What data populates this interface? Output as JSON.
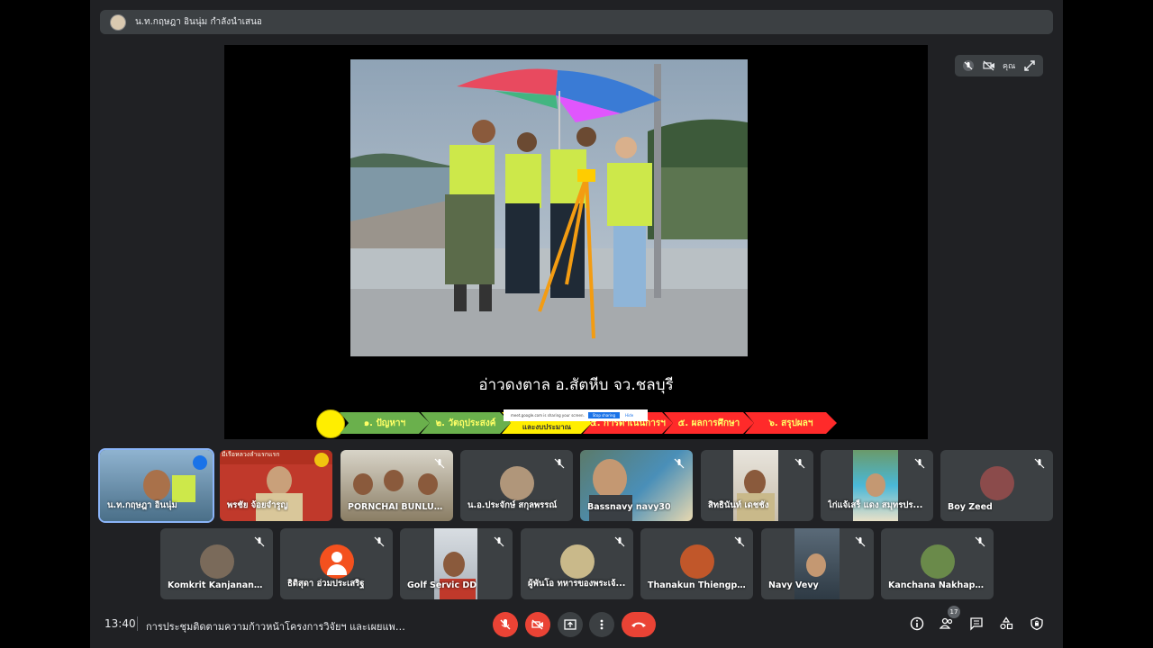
{
  "presenter": {
    "text": "น.ท.กฤษฎา อินนุ่ม กำลังนำเสนอ"
  },
  "slide": {
    "caption": "อ่าวดงตาล อ.สัตหีบ จว.ชลบุรี",
    "steps": [
      {
        "label": "๑. ปัญหาฯ",
        "color": "#6ab04c",
        "text_color": "#ffff66"
      },
      {
        "label": "๒. วัตถุประสงค์",
        "color": "#6ab04c",
        "text_color": "#ffff66"
      },
      {
        "label": "และงบประมาณ",
        "color": "#ffee00",
        "text_color": "#333333"
      },
      {
        "label": "๔. การดำเนินการฯ",
        "color": "#ff2a2a",
        "text_color": "#ffff66"
      },
      {
        "label": "๕. ผลการศึกษา",
        "color": "#ff2a2a",
        "text_color": "#ffff66"
      },
      {
        "label": "๖. สรุปผลฯ",
        "color": "#ff2a2a",
        "text_color": "#ffff66"
      }
    ]
  },
  "share_notice": {
    "text": "meet.google.com is sharing your screen.",
    "stop": "Stop sharing",
    "hide": "Hide"
  },
  "presentation_controls": {
    "you_label": "คุณ"
  },
  "participants_row1": [
    {
      "name": "น.ท.กฤษฎา อินนุ่ม",
      "bg": "#6c8fa8",
      "active": true
    },
    {
      "name": "พรชัย จ้อยจำรูญ",
      "bg": "#c0392b",
      "banner": "มีเรือหลวงลำแรกแรก"
    },
    {
      "name": "PORNCHAI BUNLUSRI",
      "bg": "#8a7d64"
    },
    {
      "name": "น.อ.ประจักษ์ สกุลพรรณ์",
      "bg": "#3c4043",
      "avatar": "#b0967a"
    },
    {
      "name": "Bassnavy navy30",
      "bg": "#4a8fb8"
    },
    {
      "name": "สิทธินันท์ เดชชัง",
      "bg": "#3c4043"
    },
    {
      "name": "ไก่แจ้เสร็ แดง สมุทรปร...",
      "bg": "#3c4043"
    },
    {
      "name": "Boy Zeed",
      "bg": "#3c4043",
      "avatar": "#8b4b4b"
    }
  ],
  "participants_row2": [
    {
      "name": "Komkrit Kanjananuwat",
      "avatar": "#7a6a5a"
    },
    {
      "name": "ธิติสุดา อ่วมประเสริฐ",
      "avatar": "#f4511e"
    },
    {
      "name": "Golf Servic DD",
      "video": true
    },
    {
      "name": "ผู้พันโอ ทหารของพระเจ้...",
      "avatar": "#c9b98a"
    },
    {
      "name": "Thanakun Thiengpree...",
      "avatar": "#c1572a"
    },
    {
      "name": "Navy Vevy",
      "video": true
    },
    {
      "name": "Kanchana Nakhapako...",
      "avatar": "#6a8a4a"
    }
  ],
  "bottom_bar": {
    "time": "13:40",
    "meeting_title": "การประชุมติดตามความก้าวหน้าโครงการวิจัยฯ และเผยแพร่...",
    "participant_count": "17"
  },
  "icons": [
    "mic-off-icon",
    "camera-off-icon",
    "present-icon",
    "more-icon",
    "hangup-icon",
    "info-icon",
    "people-icon",
    "chat-icon",
    "activities-icon",
    "host-controls-icon",
    "expand-icon"
  ]
}
